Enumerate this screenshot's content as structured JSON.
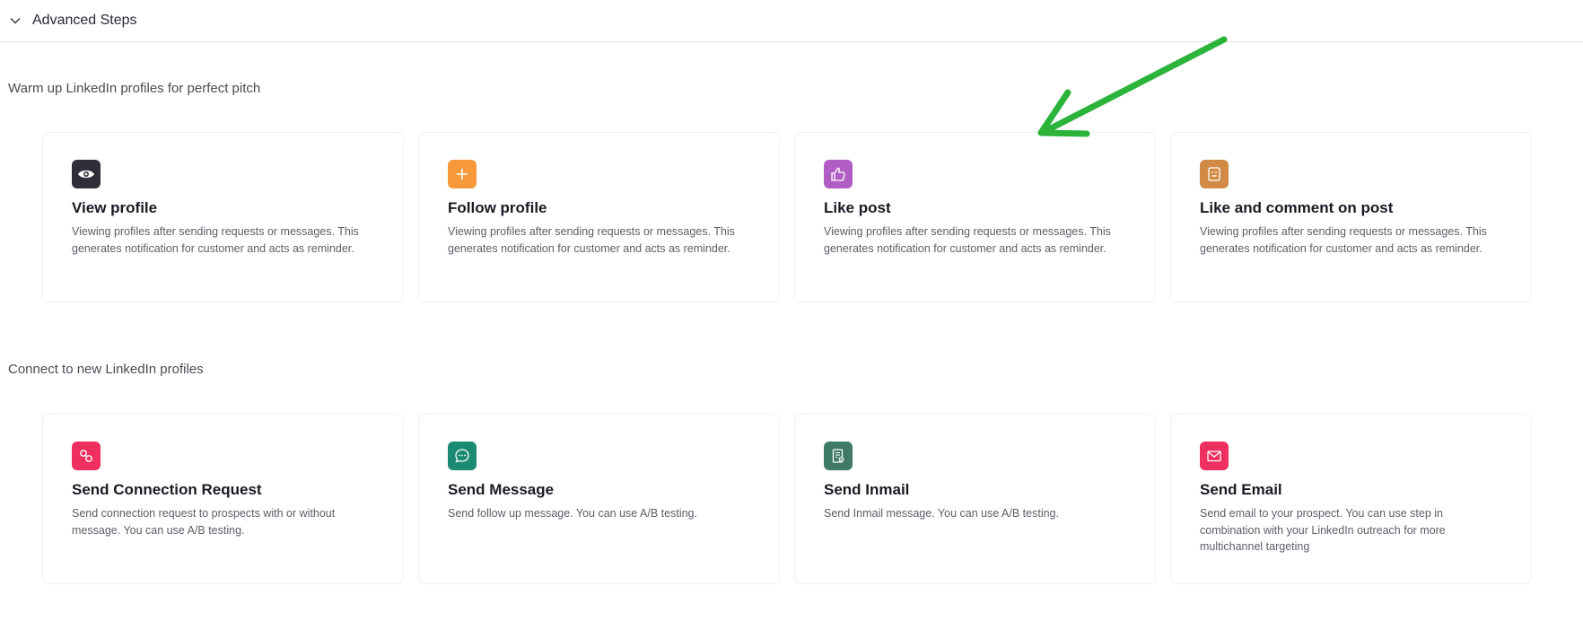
{
  "header": {
    "advanced_steps_label": "Advanced Steps"
  },
  "sections": {
    "warmup": {
      "title": "Warm up LinkedIn profiles for perfect pitch",
      "cards": [
        {
          "title": "View profile",
          "description": "Viewing profiles after sending requests or messages. This generates notification for customer and acts as reminder.",
          "icon": "eye-icon",
          "color": "#2f2f3a"
        },
        {
          "title": "Follow profile",
          "description": "Viewing profiles after sending requests or messages. This generates notification for customer and acts as reminder.",
          "icon": "plus-icon",
          "color": "#f5993a"
        },
        {
          "title": "Like post",
          "description": "Viewing profiles after sending requests or messages. This generates notification for customer and acts as reminder.",
          "icon": "thumbs-up-icon",
          "color": "#b05ec4"
        },
        {
          "title": "Like and comment on post",
          "description": "Viewing profiles after sending requests or messages. This generates notification for customer and acts as reminder.",
          "icon": "comment-box-icon",
          "color": "#d08a45"
        }
      ]
    },
    "connect": {
      "title": "Connect to new LinkedIn profiles",
      "cards": [
        {
          "title": "Send Connection Request",
          "description": "Send connection request to prospects with or without message. You can use A/B testing.",
          "icon": "link-icon",
          "color": "#ee2f5f"
        },
        {
          "title": "Send Message",
          "description": "Send follow up message. You can use A/B testing.",
          "icon": "chat-bubble-icon",
          "color": "#1a8a72"
        },
        {
          "title": "Send Inmail",
          "description": "Send Inmail message. You can use A/B testing.",
          "icon": "inmail-doc-icon",
          "color": "#3f7a66"
        },
        {
          "title": "Send Email",
          "description": "Send email to your prospect. You can use step in combination with your LinkedIn outreach for more multichannel targeting",
          "icon": "envelope-icon",
          "color": "#ee2f5f"
        }
      ]
    }
  },
  "annotation": {
    "arrow_color": "#2bb33a",
    "arrow_icon": "green-arrow-annotation"
  }
}
